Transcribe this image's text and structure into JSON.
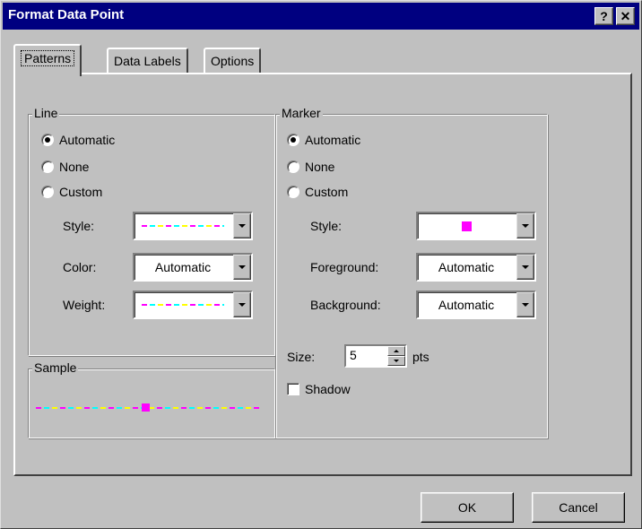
{
  "title": "Format Data Point",
  "title_buttons": {
    "help": "?",
    "close": "✕"
  },
  "tabs": [
    {
      "label": "Patterns",
      "active": true
    },
    {
      "label": "Data Labels",
      "active": false
    },
    {
      "label": "Options",
      "active": false
    }
  ],
  "line": {
    "legend": "Line",
    "radios": [
      {
        "label": "Automatic",
        "checked": true
      },
      {
        "label": "None",
        "checked": false
      },
      {
        "label": "Custom",
        "checked": false
      }
    ],
    "style_label": "Style:",
    "color_label": "Color:",
    "color_value": "Automatic",
    "weight_label": "Weight:"
  },
  "sample": {
    "legend": "Sample"
  },
  "marker": {
    "legend": "Marker",
    "radios": [
      {
        "label": "Automatic",
        "checked": true
      },
      {
        "label": "None",
        "checked": false
      },
      {
        "label": "Custom",
        "checked": false
      }
    ],
    "style_label": "Style:",
    "foreground_label": "Foreground:",
    "foreground_value": "Automatic",
    "background_label": "Background:",
    "background_value": "Automatic",
    "size_label": "Size:",
    "size_value": "5",
    "size_unit": "pts",
    "shadow_label": "Shadow",
    "shadow_checked": false
  },
  "buttons": {
    "ok": "OK",
    "cancel": "Cancel"
  },
  "colors": {
    "title_bar": "#000080",
    "face": "#c0c0c0",
    "marker": "#ff00ff",
    "dash_magenta": "#ff00ff",
    "dash_cyan": "#00ffff",
    "dash_yellow": "#ffff00"
  }
}
